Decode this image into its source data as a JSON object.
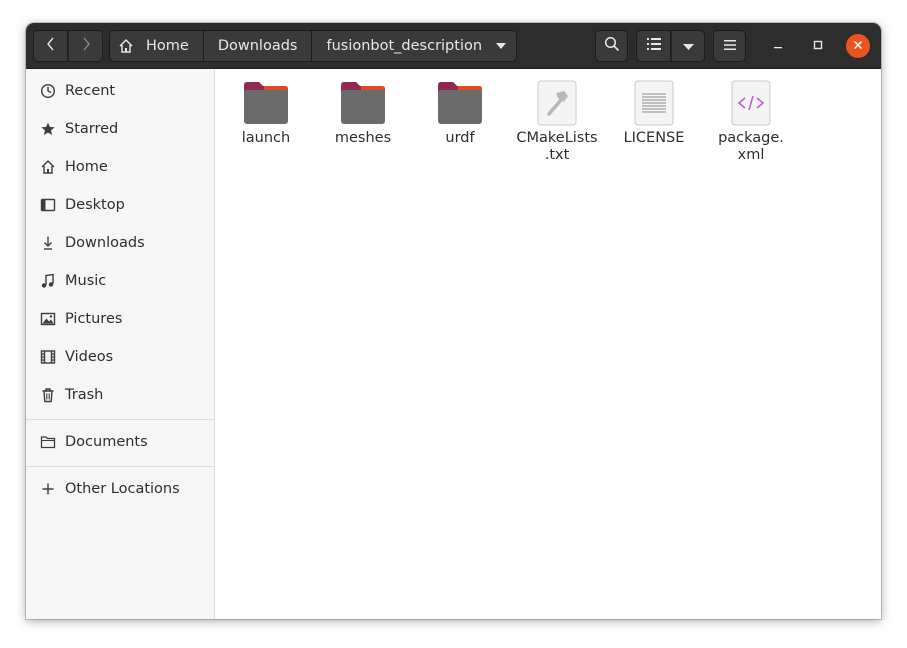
{
  "header": {
    "breadcrumbs": [
      "Home",
      "Downloads",
      "fusionbot_description"
    ],
    "icons": {
      "back": "chevron-left-icon",
      "forward": "chevron-right-icon",
      "home": "home-icon",
      "crumb_menu": "caret-down-icon",
      "search": "search-icon",
      "view_list": "list-view-icon",
      "view_options": "caret-down-icon",
      "menu": "hamburger-menu-icon",
      "minimize": "minimize-icon",
      "maximize": "maximize-icon",
      "close": "close-icon"
    },
    "close_color": "#e95420"
  },
  "sidebar": {
    "items": [
      {
        "label": "Recent",
        "icon": "clock-icon"
      },
      {
        "label": "Starred",
        "icon": "star-icon"
      },
      {
        "label": "Home",
        "icon": "home-icon"
      },
      {
        "label": "Desktop",
        "icon": "desktop-icon"
      },
      {
        "label": "Downloads",
        "icon": "download-icon"
      },
      {
        "label": "Music",
        "icon": "music-icon"
      },
      {
        "label": "Pictures",
        "icon": "picture-icon"
      },
      {
        "label": "Videos",
        "icon": "film-icon"
      },
      {
        "label": "Trash",
        "icon": "trash-icon"
      }
    ],
    "bookmarks": [
      {
        "label": "Documents",
        "icon": "folder-icon"
      }
    ],
    "other": {
      "label": "Other Locations",
      "icon": "plus-icon"
    }
  },
  "files": [
    {
      "name": "launch",
      "type": "folder",
      "icon": "folder-icon"
    },
    {
      "name": "meshes",
      "type": "folder",
      "icon": "folder-icon"
    },
    {
      "name": "urdf",
      "type": "folder",
      "icon": "folder-icon"
    },
    {
      "name": "CMakeLists\n.txt",
      "type": "cmake",
      "icon": "hammer-file-icon"
    },
    {
      "name": "LICENSE",
      "type": "text",
      "icon": "text-file-icon"
    },
    {
      "name": "package.\nxml",
      "type": "xml",
      "icon": "xml-file-icon"
    }
  ],
  "colors": {
    "folder_body": "#6b6b6b",
    "folder_tab": "#8e2b52",
    "folder_accent": "#e95420",
    "xml_glyph": "#c061cb",
    "headerbar": "#2d2d2d"
  }
}
